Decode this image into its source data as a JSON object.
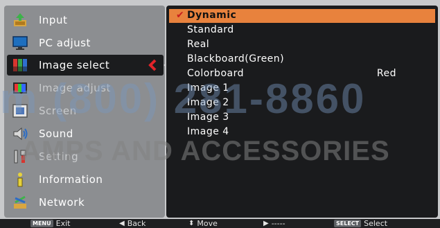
{
  "left_menu": {
    "items": [
      {
        "label": "Input",
        "icon": "input-icon"
      },
      {
        "label": "PC adjust",
        "icon": "monitor-icon"
      },
      {
        "label": "Image select",
        "icon": "image-select-icon"
      },
      {
        "label": "Image adjust",
        "icon": "image-adjust-icon"
      },
      {
        "label": "Screen",
        "icon": "screen-icon"
      },
      {
        "label": "Sound",
        "icon": "speaker-icon"
      },
      {
        "label": "Setting",
        "icon": "tools-icon"
      },
      {
        "label": "Information",
        "icon": "information-icon"
      },
      {
        "label": "Network",
        "icon": "network-icon"
      }
    ],
    "selected_index": 2
  },
  "image_select": {
    "options": [
      {
        "label": "Dynamic",
        "value": ""
      },
      {
        "label": "Standard",
        "value": ""
      },
      {
        "label": "Real",
        "value": ""
      },
      {
        "label": "Blackboard(Green)",
        "value": ""
      },
      {
        "label": "Colorboard",
        "value": "Red"
      },
      {
        "label": "Image 1",
        "value": ""
      },
      {
        "label": "Image 2",
        "value": ""
      },
      {
        "label": "Image 3",
        "value": ""
      },
      {
        "label": "Image 4",
        "value": ""
      }
    ],
    "current": "Dynamic",
    "highlight_color": "#e8823d"
  },
  "watermark": {
    "phone": "m (800) 281-8860",
    "brand": "AMPS AND ACCESSORIES"
  },
  "bottom_bar": {
    "exit_badge": "MENU",
    "exit_label": "Exit",
    "back_label": "Back",
    "move_label": "Move",
    "next_label": "-----",
    "select_badge": "SELECT",
    "select_label": "Select"
  }
}
